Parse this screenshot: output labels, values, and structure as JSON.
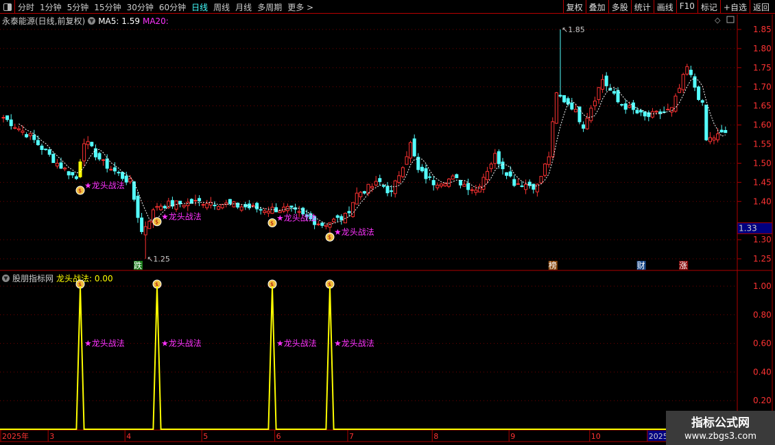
{
  "toolbar": {
    "periods": [
      "分时",
      "1分钟",
      "5分钟",
      "15分钟",
      "30分钟",
      "60分钟",
      "日线",
      "周线",
      "月线",
      "多周期",
      "更多 >"
    ],
    "active_period": "日线",
    "buttons": [
      "复权",
      "叠加",
      "多股",
      "统计",
      "画线",
      "F10",
      "标记",
      "+自选",
      "返回"
    ]
  },
  "main_panel": {
    "stock_title": "永泰能源(日线,前复权)",
    "ma5_label": "MA5: 1.59",
    "ma20_label": "MA20:",
    "high_label": "1.85",
    "low_label": "1.25",
    "current_price": "1.33",
    "signal_label": "★龙头战法",
    "y_ticks": [
      "1.85",
      "1.80",
      "1.75",
      "1.70",
      "1.65",
      "1.60",
      "1.55",
      "1.50",
      "1.45",
      "1.40",
      "1.30",
      "1.25"
    ],
    "events": [
      {
        "text": "跌",
        "color": "#1a7a1a",
        "day": 35
      },
      {
        "text": "榜",
        "color": "#8a4a10",
        "day": 143
      },
      {
        "text": "财",
        "color": "#1a4a8a",
        "day": 166
      },
      {
        "text": "涨",
        "color": "#8a0a0a",
        "day": 177
      }
    ]
  },
  "indicator_panel": {
    "name": "股朋指标网",
    "value_label": "龙头战法: 0.00",
    "signal_label": "★龙头战法",
    "y_ticks": [
      "1.00",
      "0.80",
      "0.60",
      "0.40",
      "0.20"
    ]
  },
  "date_axis": {
    "labels": [
      {
        "t": "2025年",
        "day": 0
      },
      {
        "t": "3",
        "day": 12
      },
      {
        "t": "4",
        "day": 32
      },
      {
        "t": "5",
        "day": 52
      },
      {
        "t": "6",
        "day": 71
      },
      {
        "t": "7",
        "day": 90
      },
      {
        "t": "8",
        "day": 112
      },
      {
        "t": "9",
        "day": 132
      },
      {
        "t": "10",
        "day": 153
      },
      {
        "t": "2025",
        "day": 168
      }
    ]
  },
  "watermark": {
    "line1": "指标公式网",
    "line2": "www.zbgs3.com"
  },
  "colors": {
    "up": "#ff3232",
    "down": "#54ffff",
    "grid": "#b00000",
    "signal": "#ff33ff",
    "indicator": "#ffff00"
  },
  "chart_data": {
    "type": "candlestick",
    "price_keypoints": [
      [
        0,
        1.62
      ],
      [
        7,
        1.57
      ],
      [
        14,
        1.5
      ],
      [
        19,
        1.46
      ],
      [
        21,
        1.56
      ],
      [
        26,
        1.5
      ],
      [
        33,
        1.45
      ],
      [
        36,
        1.32
      ],
      [
        40,
        1.39
      ],
      [
        53,
        1.4
      ],
      [
        67,
        1.38
      ],
      [
        74,
        1.38
      ],
      [
        83,
        1.34
      ],
      [
        89,
        1.36
      ],
      [
        92,
        1.42
      ],
      [
        98,
        1.45
      ],
      [
        101,
        1.42
      ],
      [
        106,
        1.55
      ],
      [
        108,
        1.48
      ],
      [
        112,
        1.45
      ],
      [
        117,
        1.46
      ],
      [
        123,
        1.43
      ],
      [
        128,
        1.52
      ],
      [
        133,
        1.45
      ],
      [
        139,
        1.44
      ],
      [
        142,
        1.52
      ],
      [
        144,
        1.68
      ],
      [
        148,
        1.65
      ],
      [
        151,
        1.6
      ],
      [
        156,
        1.72
      ],
      [
        160,
        1.66
      ],
      [
        167,
        1.62
      ],
      [
        174,
        1.64
      ],
      [
        178,
        1.75
      ],
      [
        182,
        1.65
      ],
      [
        183,
        1.56
      ],
      [
        188,
        1.58
      ]
    ],
    "high": {
      "day": 145,
      "price": 1.85
    },
    "low": {
      "day": 37,
      "price": 1.25
    },
    "signal_days": [
      20,
      40,
      70,
      85
    ],
    "ylim": [
      1.22,
      1.88
    ],
    "indicator_ylim": [
      0,
      1.05
    ]
  }
}
